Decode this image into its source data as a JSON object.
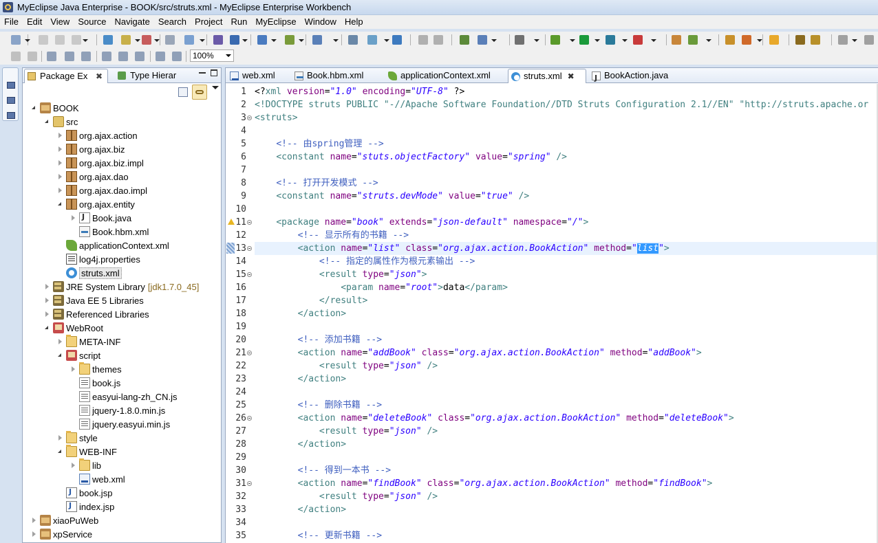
{
  "window": {
    "title": "MyEclipse Java Enterprise - BOOK/src/struts.xml - MyEclipse Enterprise Workbench"
  },
  "menubar": {
    "items": [
      "File",
      "Edit",
      "View",
      "Source",
      "Navigate",
      "Search",
      "Project",
      "Run",
      "MyEclipse",
      "Window",
      "Help"
    ]
  },
  "toolbar": {
    "zoom": "100%"
  },
  "package_explorer": {
    "tabs": [
      {
        "label": "Package Ex",
        "close": "✖"
      },
      {
        "label": "Type Hierar"
      }
    ],
    "tree": [
      {
        "label": "BOOK",
        "icon": "project-icon",
        "depth": 0,
        "state": "expanded"
      },
      {
        "label": "src",
        "icon": "source-folder-icon",
        "depth": 1,
        "state": "expanded"
      },
      {
        "label": "org.ajax.action",
        "icon": "package-icon",
        "depth": 2,
        "state": "collapsed"
      },
      {
        "label": "org.ajax.biz",
        "icon": "package-icon",
        "depth": 2,
        "state": "collapsed"
      },
      {
        "label": "org.ajax.biz.impl",
        "icon": "package-icon",
        "depth": 2,
        "state": "collapsed"
      },
      {
        "label": "org.ajax.dao",
        "icon": "package-icon",
        "depth": 2,
        "state": "collapsed"
      },
      {
        "label": "org.ajax.dao.impl",
        "icon": "package-icon",
        "depth": 2,
        "state": "collapsed"
      },
      {
        "label": "org.ajax.entity",
        "icon": "package-icon",
        "depth": 2,
        "state": "expanded"
      },
      {
        "label": "Book.java",
        "icon": "java-file-icon",
        "depth": 3,
        "state": "collapsed"
      },
      {
        "label": "Book.hbm.xml",
        "icon": "xml-file-icon",
        "depth": 3,
        "state": "leaf"
      },
      {
        "label": "applicationContext.xml",
        "icon": "spring-file-icon",
        "depth": 2,
        "state": "leaf"
      },
      {
        "label": "log4j.properties",
        "icon": "properties-file-icon",
        "depth": 2,
        "state": "leaf"
      },
      {
        "label": "struts.xml",
        "icon": "struts-file-icon",
        "depth": 2,
        "state": "leaf",
        "selected": true
      },
      {
        "label": "JRE System Library",
        "decoration": "[jdk1.7.0_45]",
        "icon": "library-icon",
        "depth": 1,
        "state": "collapsed"
      },
      {
        "label": "Java EE 5 Libraries",
        "icon": "library-icon",
        "depth": 1,
        "state": "collapsed"
      },
      {
        "label": "Referenced Libraries",
        "icon": "library-icon",
        "depth": 1,
        "state": "collapsed"
      },
      {
        "label": "WebRoot",
        "icon": "webroot-icon",
        "depth": 1,
        "state": "expanded"
      },
      {
        "label": "META-INF",
        "icon": "folder-icon",
        "depth": 2,
        "state": "collapsed"
      },
      {
        "label": "script",
        "icon": "script-folder-icon",
        "depth": 2,
        "state": "expanded"
      },
      {
        "label": "themes",
        "icon": "folder-icon",
        "depth": 3,
        "state": "collapsed"
      },
      {
        "label": "book.js",
        "icon": "js-file-icon",
        "depth": 3,
        "state": "leaf"
      },
      {
        "label": "easyui-lang-zh_CN.js",
        "icon": "js-file-icon",
        "depth": 3,
        "state": "leaf"
      },
      {
        "label": "jquery-1.8.0.min.js",
        "icon": "js-file-icon",
        "depth": 3,
        "state": "leaf"
      },
      {
        "label": "jquery.easyui.min.js",
        "icon": "js-file-icon",
        "depth": 3,
        "state": "leaf"
      },
      {
        "label": "style",
        "icon": "folder-icon",
        "depth": 2,
        "state": "collapsed"
      },
      {
        "label": "WEB-INF",
        "icon": "folder-icon",
        "depth": 2,
        "state": "expanded"
      },
      {
        "label": "lib",
        "icon": "folder-icon",
        "depth": 3,
        "state": "collapsed"
      },
      {
        "label": "web.xml",
        "icon": "web-xml-icon",
        "depth": 3,
        "state": "leaf"
      },
      {
        "label": "book.jsp",
        "icon": "jsp-file-icon",
        "depth": 2,
        "state": "leaf"
      },
      {
        "label": "index.jsp",
        "icon": "jsp-file-icon",
        "depth": 2,
        "state": "leaf"
      },
      {
        "label": "xiaoPuWeb",
        "icon": "project-icon",
        "depth": 0,
        "state": "collapsed"
      },
      {
        "label": "xpService",
        "icon": "project-icon",
        "depth": 0,
        "state": "collapsed"
      }
    ]
  },
  "editor": {
    "tabs": [
      {
        "label": "web.xml",
        "icon": "web-xml-icon"
      },
      {
        "label": "Book.hbm.xml",
        "icon": "xml-file-icon"
      },
      {
        "label": "applicationContext.xml",
        "icon": "spring-file-icon"
      },
      {
        "label": "struts.xml",
        "icon": "struts-file-icon",
        "active": true,
        "close": "✖"
      },
      {
        "label": "BookAction.java",
        "icon": "java-file-icon"
      }
    ],
    "lines": [
      {
        "n": "1",
        "tokens": [
          [
            "t",
            "<?"
          ],
          [
            "tag",
            "xml"
          ],
          [
            "t",
            " "
          ],
          [
            "attr",
            "version"
          ],
          [
            "t",
            "="
          ],
          [
            "val",
            "\"1.0\""
          ],
          [
            "t",
            " "
          ],
          [
            "attr",
            "encoding"
          ],
          [
            "t",
            "="
          ],
          [
            "val",
            "\"UTF-8\""
          ],
          [
            "t",
            " ?>"
          ]
        ]
      },
      {
        "n": "2",
        "tokens": [
          [
            "tag",
            "<!DOCTYPE struts PUBLIC \"-//Apache Software Foundation//DTD Struts Configuration 2.1//EN\" \"http://struts.apache.or"
          ]
        ]
      },
      {
        "n": "3",
        "fold": true,
        "tokens": [
          [
            "tag",
            "<struts>"
          ]
        ]
      },
      {
        "n": "4",
        "tokens": []
      },
      {
        "n": "5",
        "tokens": [
          [
            "t",
            "    "
          ],
          [
            "cmt",
            "<!-- 由spring管理 -->"
          ]
        ]
      },
      {
        "n": "6",
        "tokens": [
          [
            "t",
            "    "
          ],
          [
            "tag",
            "<constant"
          ],
          [
            "t",
            " "
          ],
          [
            "attr",
            "name"
          ],
          [
            "t",
            "="
          ],
          [
            "val",
            "\"stuts.objectFactory\""
          ],
          [
            "t",
            " "
          ],
          [
            "attr",
            "value"
          ],
          [
            "t",
            "="
          ],
          [
            "val",
            "\"spring\""
          ],
          [
            "t",
            " "
          ],
          [
            "tag",
            "/>"
          ]
        ]
      },
      {
        "n": "7",
        "tokens": []
      },
      {
        "n": "8",
        "tokens": [
          [
            "t",
            "    "
          ],
          [
            "cmt",
            "<!-- 打开开发模式 -->"
          ]
        ]
      },
      {
        "n": "9",
        "tokens": [
          [
            "t",
            "    "
          ],
          [
            "tag",
            "<constant"
          ],
          [
            "t",
            " "
          ],
          [
            "attr",
            "name"
          ],
          [
            "t",
            "="
          ],
          [
            "val",
            "\"struts.devMode\""
          ],
          [
            "t",
            " "
          ],
          [
            "attr",
            "value"
          ],
          [
            "t",
            "="
          ],
          [
            "val",
            "\"true\""
          ],
          [
            "t",
            " "
          ],
          [
            "tag",
            "/>"
          ]
        ]
      },
      {
        "n": "10",
        "tokens": []
      },
      {
        "n": "11",
        "fold": true,
        "warn": true,
        "tokens": [
          [
            "t",
            "    "
          ],
          [
            "tag",
            "<package"
          ],
          [
            "t",
            " "
          ],
          [
            "attr",
            "name"
          ],
          [
            "t",
            "="
          ],
          [
            "val",
            "\"book\""
          ],
          [
            "t",
            " "
          ],
          [
            "attr",
            "extends"
          ],
          [
            "t",
            "="
          ],
          [
            "val",
            "\"json-default\""
          ],
          [
            "t",
            " "
          ],
          [
            "attr",
            "namespace"
          ],
          [
            "t",
            "="
          ],
          [
            "val",
            "\"/\""
          ],
          [
            "tag",
            ">"
          ]
        ]
      },
      {
        "n": "12",
        "tokens": [
          [
            "t",
            "        "
          ],
          [
            "cmt",
            "<!-- 显示所有的书籍 -->"
          ]
        ]
      },
      {
        "n": "13",
        "fold": true,
        "marker": true,
        "current": true,
        "tokens": [
          [
            "t",
            "        "
          ],
          [
            "tag",
            "<action"
          ],
          [
            "t",
            " "
          ],
          [
            "attr",
            "name"
          ],
          [
            "t",
            "="
          ],
          [
            "val",
            "\"list\""
          ],
          [
            "t",
            " "
          ],
          [
            "attr",
            "class"
          ],
          [
            "t",
            "="
          ],
          [
            "val",
            "\"org.ajax.action.BookAction\""
          ],
          [
            "t",
            " "
          ],
          [
            "attr",
            "method"
          ],
          [
            "t",
            "="
          ],
          [
            "val",
            "\""
          ],
          [
            "sel",
            "list"
          ],
          [
            "val",
            "\""
          ],
          [
            "tag",
            ">"
          ]
        ]
      },
      {
        "n": "14",
        "tokens": [
          [
            "t",
            "            "
          ],
          [
            "cmt",
            "<!-- 指定的属性作为根元素输出 -->"
          ]
        ]
      },
      {
        "n": "15",
        "fold": true,
        "tokens": [
          [
            "t",
            "            "
          ],
          [
            "tag",
            "<result"
          ],
          [
            "t",
            " "
          ],
          [
            "attr",
            "type"
          ],
          [
            "t",
            "="
          ],
          [
            "val",
            "\"json\""
          ],
          [
            "tag",
            ">"
          ]
        ]
      },
      {
        "n": "16",
        "tokens": [
          [
            "t",
            "                "
          ],
          [
            "tag",
            "<param"
          ],
          [
            "t",
            " "
          ],
          [
            "attr",
            "name"
          ],
          [
            "t",
            "="
          ],
          [
            "val",
            "\"root\""
          ],
          [
            "tag",
            ">"
          ],
          [
            "t",
            "data"
          ],
          [
            "tag",
            "</param>"
          ]
        ]
      },
      {
        "n": "17",
        "tokens": [
          [
            "t",
            "            "
          ],
          [
            "tag",
            "</result>"
          ]
        ]
      },
      {
        "n": "18",
        "tokens": [
          [
            "t",
            "        "
          ],
          [
            "tag",
            "</action>"
          ]
        ]
      },
      {
        "n": "19",
        "tokens": []
      },
      {
        "n": "20",
        "tokens": [
          [
            "t",
            "        "
          ],
          [
            "cmt",
            "<!-- 添加书籍 -->"
          ]
        ]
      },
      {
        "n": "21",
        "fold": true,
        "tokens": [
          [
            "t",
            "        "
          ],
          [
            "tag",
            "<action"
          ],
          [
            "t",
            " "
          ],
          [
            "attr",
            "name"
          ],
          [
            "t",
            "="
          ],
          [
            "val",
            "\"addBook\""
          ],
          [
            "t",
            " "
          ],
          [
            "attr",
            "class"
          ],
          [
            "t",
            "="
          ],
          [
            "val",
            "\"org.ajax.action.BookAction\""
          ],
          [
            "t",
            " "
          ],
          [
            "attr",
            "method"
          ],
          [
            "t",
            "="
          ],
          [
            "val",
            "\"addBook\""
          ],
          [
            "tag",
            ">"
          ]
        ]
      },
      {
        "n": "22",
        "tokens": [
          [
            "t",
            "            "
          ],
          [
            "tag",
            "<result"
          ],
          [
            "t",
            " "
          ],
          [
            "attr",
            "type"
          ],
          [
            "t",
            "="
          ],
          [
            "val",
            "\"json\""
          ],
          [
            "t",
            " "
          ],
          [
            "tag",
            "/>"
          ]
        ]
      },
      {
        "n": "23",
        "tokens": [
          [
            "t",
            "        "
          ],
          [
            "tag",
            "</action>"
          ]
        ]
      },
      {
        "n": "24",
        "tokens": []
      },
      {
        "n": "25",
        "tokens": [
          [
            "t",
            "        "
          ],
          [
            "cmt",
            "<!-- 删除书籍 -->"
          ]
        ]
      },
      {
        "n": "26",
        "fold": true,
        "tokens": [
          [
            "t",
            "        "
          ],
          [
            "tag",
            "<action"
          ],
          [
            "t",
            " "
          ],
          [
            "attr",
            "name"
          ],
          [
            "t",
            "="
          ],
          [
            "val",
            "\"deleteBook\""
          ],
          [
            "t",
            " "
          ],
          [
            "attr",
            "class"
          ],
          [
            "t",
            "="
          ],
          [
            "val",
            "\"org.ajax.action.BookAction\""
          ],
          [
            "t",
            " "
          ],
          [
            "attr",
            "method"
          ],
          [
            "t",
            "="
          ],
          [
            "val",
            "\"deleteBook\""
          ],
          [
            "tag",
            ">"
          ]
        ]
      },
      {
        "n": "27",
        "tokens": [
          [
            "t",
            "            "
          ],
          [
            "tag",
            "<result"
          ],
          [
            "t",
            " "
          ],
          [
            "attr",
            "type"
          ],
          [
            "t",
            "="
          ],
          [
            "val",
            "\"json\""
          ],
          [
            "t",
            " "
          ],
          [
            "tag",
            "/>"
          ]
        ]
      },
      {
        "n": "28",
        "tokens": [
          [
            "t",
            "        "
          ],
          [
            "tag",
            "</action>"
          ]
        ]
      },
      {
        "n": "29",
        "tokens": []
      },
      {
        "n": "30",
        "tokens": [
          [
            "t",
            "        "
          ],
          [
            "cmt",
            "<!-- 得到一本书 -->"
          ]
        ]
      },
      {
        "n": "31",
        "fold": true,
        "tokens": [
          [
            "t",
            "        "
          ],
          [
            "tag",
            "<action"
          ],
          [
            "t",
            " "
          ],
          [
            "attr",
            "name"
          ],
          [
            "t",
            "="
          ],
          [
            "val",
            "\"findBook\""
          ],
          [
            "t",
            " "
          ],
          [
            "attr",
            "class"
          ],
          [
            "t",
            "="
          ],
          [
            "val",
            "\"org.ajax.action.BookAction\""
          ],
          [
            "t",
            " "
          ],
          [
            "attr",
            "method"
          ],
          [
            "t",
            "="
          ],
          [
            "val",
            "\"findBook\""
          ],
          [
            "tag",
            ">"
          ]
        ]
      },
      {
        "n": "32",
        "tokens": [
          [
            "t",
            "            "
          ],
          [
            "tag",
            "<result"
          ],
          [
            "t",
            " "
          ],
          [
            "attr",
            "type"
          ],
          [
            "t",
            "="
          ],
          [
            "val",
            "\"json\""
          ],
          [
            "t",
            " "
          ],
          [
            "tag",
            "/>"
          ]
        ]
      },
      {
        "n": "33",
        "tokens": [
          [
            "t",
            "        "
          ],
          [
            "tag",
            "</action>"
          ]
        ]
      },
      {
        "n": "34",
        "tokens": []
      },
      {
        "n": "35",
        "tokens": [
          [
            "t",
            "        "
          ],
          [
            "cmt",
            "<!-- 更新书籍 -->"
          ]
        ]
      }
    ]
  },
  "colors": {
    "tag": "#3f7f7f",
    "attr": "#7f007f",
    "value": "#2a00ff",
    "comment": "#3f5fbf",
    "selection": "#3399ff",
    "current_line": "#e8f2fe"
  }
}
